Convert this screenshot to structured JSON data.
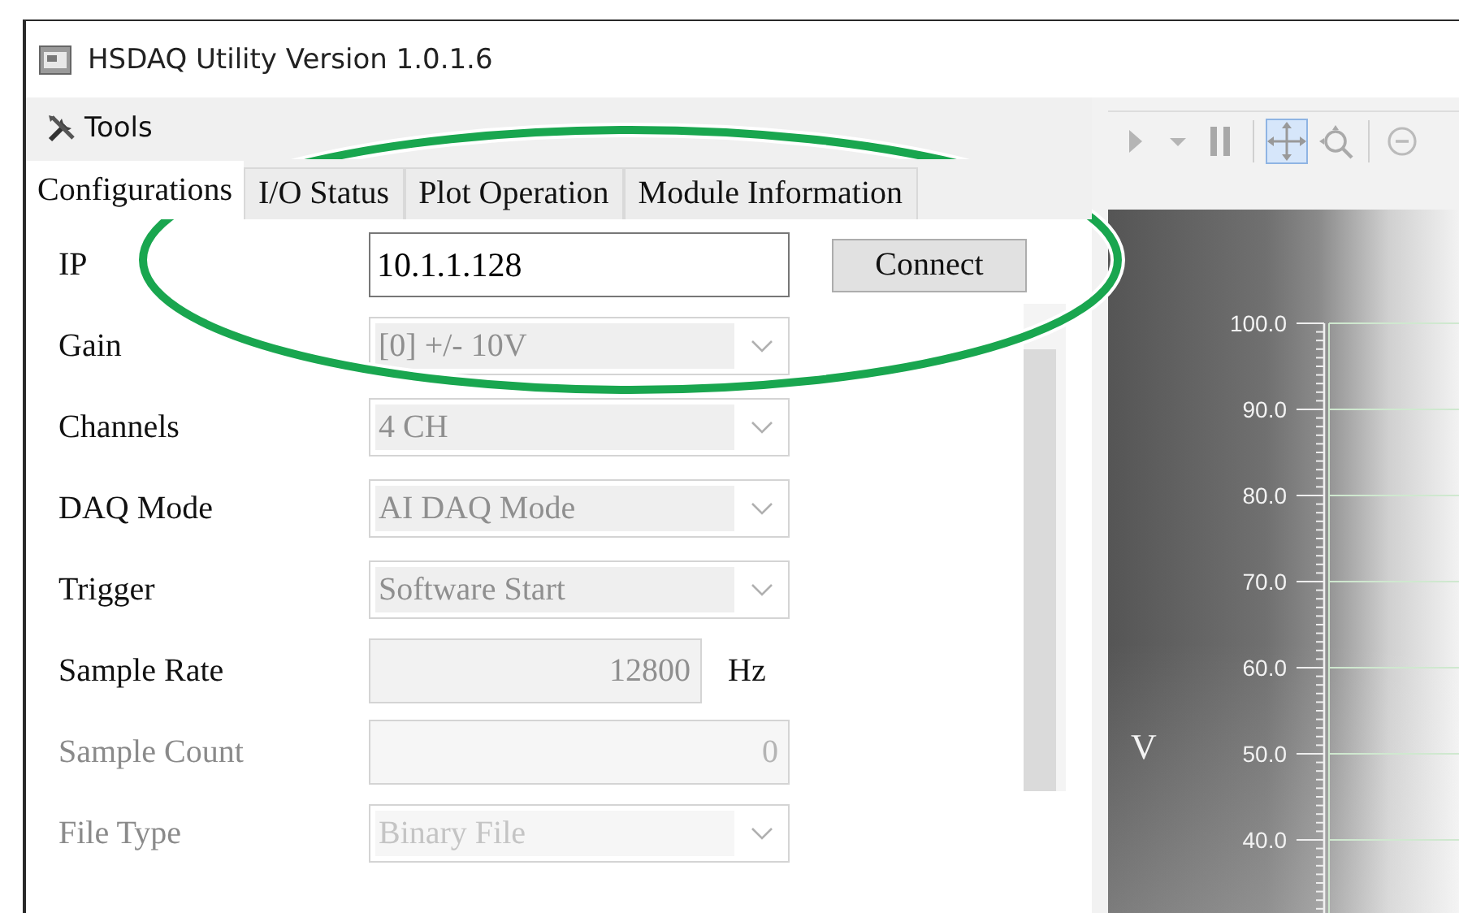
{
  "window": {
    "title": "HSDAQ Utility Version 1.0.1.6"
  },
  "menu": [
    {
      "label": "Tools"
    }
  ],
  "tabs": [
    {
      "label": "Configurations",
      "selected": true
    },
    {
      "label": "I/O Status",
      "selected": false
    },
    {
      "label": "Plot Operation",
      "selected": false
    },
    {
      "label": "Module Information",
      "selected": false
    }
  ],
  "form": [
    {
      "label": "IP",
      "kind": "text",
      "value": "10.1.1.128",
      "disabled": false,
      "button": "Connect"
    },
    {
      "label": "Gain",
      "kind": "select",
      "value": "[0] +/- 10V",
      "disabled": false
    },
    {
      "label": "Channels",
      "kind": "select",
      "value": "4 CH",
      "disabled": false
    },
    {
      "label": "DAQ Mode",
      "kind": "select",
      "value": "AI DAQ Mode",
      "disabled": false
    },
    {
      "label": "Trigger",
      "kind": "select",
      "value": "Software Start",
      "disabled": false
    },
    {
      "label": "Sample Rate",
      "kind": "number",
      "value": "12800",
      "unit": "Hz",
      "disabled": false
    },
    {
      "label": "Sample Count",
      "kind": "number",
      "value": "0",
      "disabled": true
    },
    {
      "label": "File Type",
      "kind": "select",
      "value": "Binary File",
      "disabled": true
    }
  ],
  "toolbar": [
    {
      "kind": "play",
      "selected": false
    },
    {
      "kind": "caret",
      "selected": false
    },
    {
      "kind": "pause",
      "selected": false
    },
    {
      "kind": "separator"
    },
    {
      "kind": "pan",
      "selected": true
    },
    {
      "kind": "zoom",
      "selected": false
    },
    {
      "kind": "separator"
    },
    {
      "kind": "zoom-out",
      "selected": false
    }
  ],
  "plot": {
    "y_axis_label": "V",
    "y_ticks": [
      "100.0",
      "90.0",
      "80.0",
      "70.0",
      "60.0",
      "50.0",
      "40.0"
    ]
  }
}
